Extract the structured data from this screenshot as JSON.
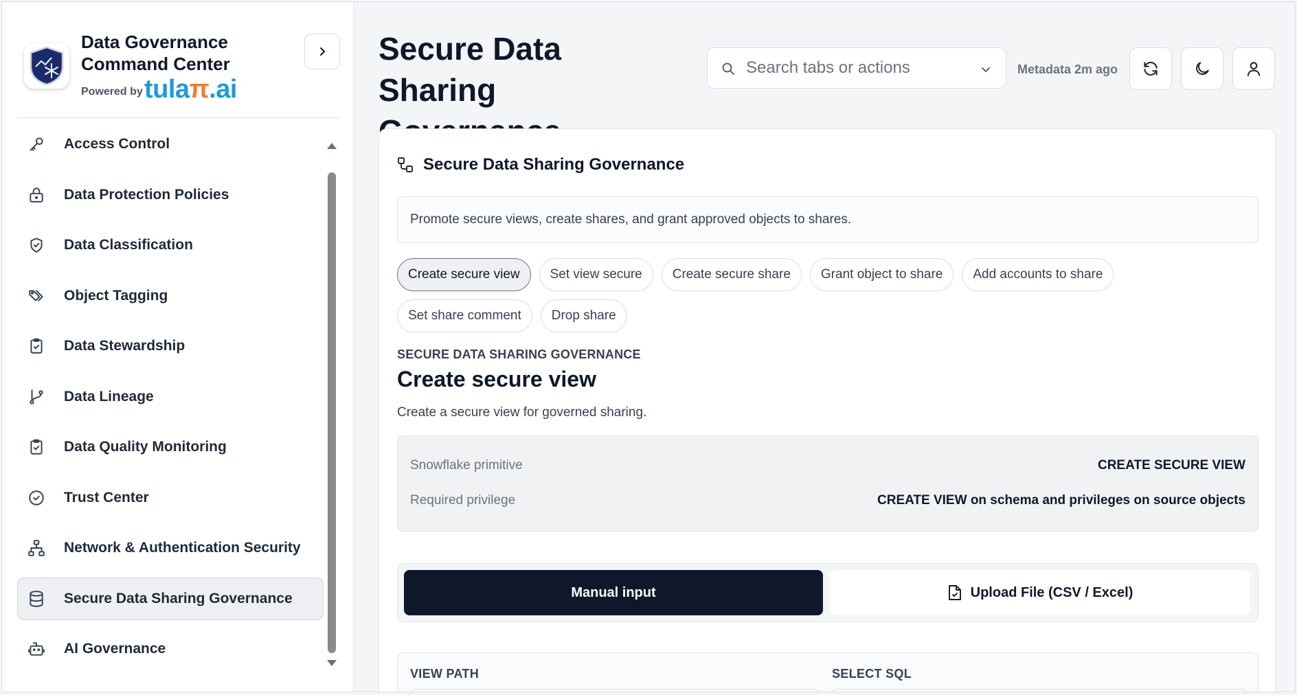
{
  "brand": {
    "title": "Data Governance Command Center",
    "powered_by": "Powered by",
    "logo_text_a": "tula",
    "logo_text_b": "π",
    "logo_text_c": ".ai"
  },
  "sidebar": {
    "items": [
      {
        "label": "Access Control",
        "icon": "key-icon",
        "active": false
      },
      {
        "label": "Data Protection Policies",
        "icon": "lock-icon",
        "active": false
      },
      {
        "label": "Data Classification",
        "icon": "shield-check-icon",
        "active": false
      },
      {
        "label": "Object Tagging",
        "icon": "tags-icon",
        "active": false
      },
      {
        "label": "Data Stewardship",
        "icon": "clipboard-check-icon",
        "active": false
      },
      {
        "label": "Data Lineage",
        "icon": "git-branch-icon",
        "active": false
      },
      {
        "label": "Data Quality Monitoring",
        "icon": "clipboard-check-icon",
        "active": false
      },
      {
        "label": "Trust Center",
        "icon": "check-circle-icon",
        "active": false
      },
      {
        "label": "Network & Authentication Security",
        "icon": "network-icon",
        "active": false
      },
      {
        "label": "Secure Data Sharing Governance",
        "icon": "database-icon",
        "active": true
      },
      {
        "label": "AI Governance",
        "icon": "bot-icon",
        "active": false
      }
    ]
  },
  "header": {
    "title": "Secure Data Sharing Governance",
    "search_placeholder": "Search tabs or actions",
    "metadata": "Metadata 2m ago"
  },
  "card": {
    "title": "Secure Data Sharing Governance",
    "description": "Promote secure views, create shares, and grant approved objects to shares.",
    "actions": [
      {
        "label": "Create secure view",
        "active": true
      },
      {
        "label": "Set view secure",
        "active": false
      },
      {
        "label": "Create secure share",
        "active": false
      },
      {
        "label": "Grant object to share",
        "active": false
      },
      {
        "label": "Add accounts to share",
        "active": false
      },
      {
        "label": "Set share comment",
        "active": false
      },
      {
        "label": "Drop share",
        "active": false
      }
    ],
    "eyebrow": "SECURE DATA SHARING GOVERNANCE",
    "section_title": "Create secure view",
    "section_desc": "Create a secure view for governed sharing.",
    "details": [
      {
        "key": "Snowflake primitive",
        "value": "CREATE SECURE VIEW"
      },
      {
        "key": "Required privilege",
        "value": "CREATE VIEW on schema and privileges on source objects"
      }
    ],
    "modes": {
      "manual": "Manual input",
      "upload": "Upload File (CSV / Excel)"
    },
    "fields": {
      "view_path": "VIEW PATH",
      "select_sql": "SELECT SQL"
    }
  },
  "colors": {
    "primary_dark": "#0f172a",
    "brand_blue": "#1e9bd7",
    "brand_orange": "#f07d2e"
  }
}
